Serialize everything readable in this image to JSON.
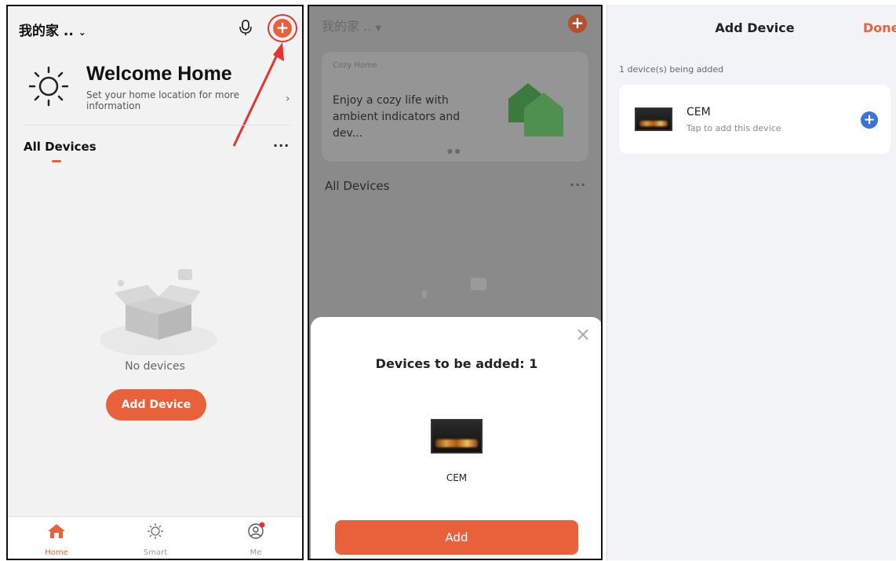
{
  "home": {
    "home_name": "我的家 ..",
    "welcome_title": "Welcome Home",
    "welcome_sub": "Set your home location for more information",
    "section_title": "All Devices",
    "more": "···",
    "empty_text": "No devices",
    "add_button": "Add Device",
    "tabs": [
      {
        "label": "Home",
        "icon": "home-icon"
      },
      {
        "label": "Smart",
        "icon": "sun-icon"
      },
      {
        "label": "Me",
        "icon": "person-icon"
      }
    ],
    "accent": "#e8613a",
    "highlight": "#e3342f"
  },
  "dialog": {
    "home_name": "我的家 ..",
    "banner_label": "Cozy Home",
    "banner_text": "Enjoy a cozy life with ambient indicators and dev...",
    "section_title": "All Devices",
    "more": "···",
    "sheet_title": "Devices to be added: 1",
    "device_name": "CEM",
    "add_button": "Add",
    "close": "×"
  },
  "add_device": {
    "title": "Add Device",
    "done": "Done",
    "status": "1 device(s) being added",
    "device_name": "CEM",
    "device_hint": "Tap to add this device",
    "plus_color": "#3b74d8"
  }
}
